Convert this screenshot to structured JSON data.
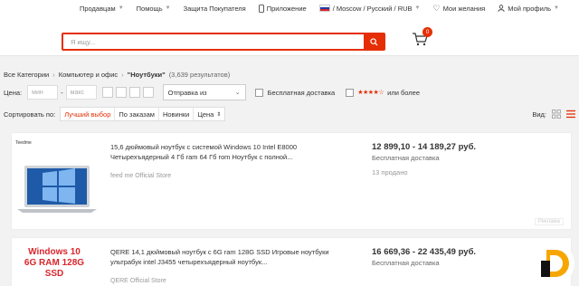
{
  "topnav": {
    "seller": "Продавцам",
    "help": "Помощь",
    "protection": "Защита Покупателя",
    "app": "Приложение",
    "region": "/ Moscow / Русский / RUB",
    "wishlist": "Мои желания",
    "profile": "Мой профиль"
  },
  "search": {
    "placeholder": "Я ищу...",
    "value": ""
  },
  "cart": {
    "count": "0"
  },
  "breadcrumb": {
    "root": "Все Категории",
    "category": "Компьютер и офис",
    "query": "\"Ноутбуки\"",
    "results": "(3,639 результатов)"
  },
  "filters": {
    "price_label": "Цена:",
    "min_placeholder": "мин",
    "max_placeholder": "макс",
    "ship_from": "Отправка из",
    "free_shipping": "Бесплатная доставка",
    "rating_stars": "★★★★☆",
    "rating_suffix": "или более"
  },
  "sort": {
    "label": "Сортировать по:",
    "options": [
      "Лучший выбор",
      "По заказам",
      "Новинки",
      "Цена"
    ],
    "view_label": "Вид:"
  },
  "products": [
    {
      "brand": "Teedme",
      "title": "15,6 дюймовый ноутбук с системой Windows 10 Intel E8000 Четырехъядерный 4 Гб ram 64 Гб rom Ноутбук с полной...",
      "price": "12 899,10 - 14 189,27 руб.",
      "shipping": "Бесплатная доставка",
      "sold": "13 продано",
      "store": "feed me Official Store",
      "ad": "Реклама"
    },
    {
      "promo": "Windows 10 6G RAM 128G SSD",
      "title": "QERE 14,1 дюймовый ноутбук с 6G ram 128G SSD Игровые ноутбуки ультрабук intel J3455 четырехъядерный ноутбук...",
      "price": "16 669,36 - 22 435,49 руб.",
      "shipping": "Бесплатная доставка",
      "store": "QERE Official Store"
    }
  ],
  "colors": {
    "accent": "#e62e04",
    "logo_orange": "#f7a600"
  }
}
